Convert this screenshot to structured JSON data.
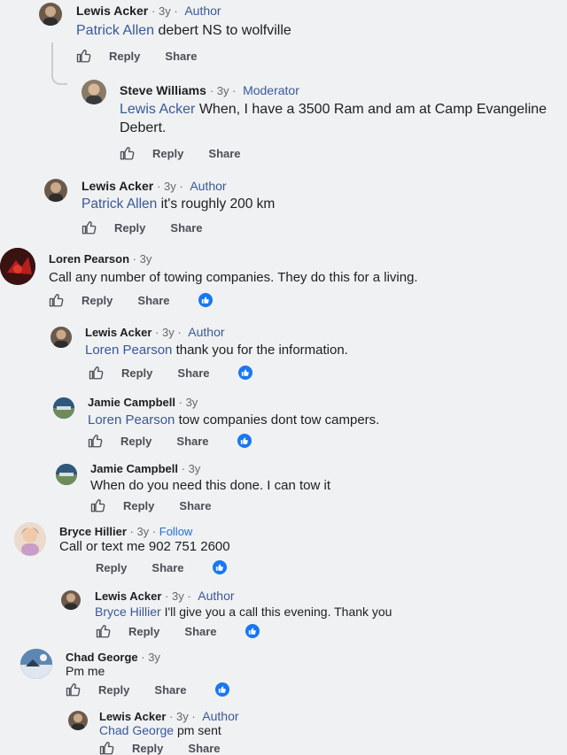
{
  "actions": {
    "reply": "Reply",
    "share": "Share"
  },
  "comments": [
    {
      "name": "Lewis Acker",
      "time": "3y",
      "badge": "Author",
      "mention": "Patrick Allen",
      "text": " debert NS to wolfville",
      "reacted": false
    },
    {
      "name": "Steve Williams",
      "time": "3y",
      "badge": "Moderator",
      "mention": "Lewis Acker",
      "text": " When, I have a 3500 Ram and am at Camp Evangeline Debert.",
      "reacted": false
    },
    {
      "name": "Lewis Acker",
      "time": "3y",
      "badge": "Author",
      "mention": "Patrick Allen",
      "text": " it's roughly 200 km",
      "reacted": false
    },
    {
      "name": "Loren Pearson",
      "time": "3y",
      "badge": "",
      "mention": "",
      "text": "Call any number of towing companies. They do this for a living.",
      "reacted": true
    },
    {
      "name": "Lewis Acker",
      "time": "3y",
      "badge": "Author",
      "mention": "Loren Pearson",
      "text": " thank you for the information.",
      "reacted": true
    },
    {
      "name": "Jamie Campbell",
      "time": "3y",
      "badge": "",
      "mention": "Loren Pearson",
      "text": " tow companies dont tow campers.",
      "reacted": true
    },
    {
      "name": "Jamie Campbell",
      "time": "3y",
      "badge": "",
      "mention": "",
      "text": "When do you need this done. I can tow it",
      "reacted": false
    },
    {
      "name": "Bryce Hillier",
      "time": "3y",
      "badge": "",
      "follow": "Follow",
      "mention": "",
      "text": "Call or text me 902 751 2600",
      "reacted": true
    },
    {
      "name": "Lewis Acker",
      "time": "3y",
      "badge": "Author",
      "mention": "Bryce Hillier",
      "text": " I'll give you a call this evening. Thank you",
      "reacted": true
    },
    {
      "name": "Chad George",
      "time": "3y",
      "badge": "",
      "mention": "",
      "text": "Pm me",
      "reacted": true
    },
    {
      "name": "Lewis Acker",
      "time": "3y",
      "badge": "Author",
      "mention": "Chad George",
      "text": " pm sent",
      "reacted": false
    }
  ],
  "icons": {
    "like": "thumbs-up-icon",
    "reaction": "like-reaction-icon"
  },
  "colors": {
    "mention": "#385898",
    "reaction": "#1877f2",
    "background": "#f0f1f3"
  }
}
